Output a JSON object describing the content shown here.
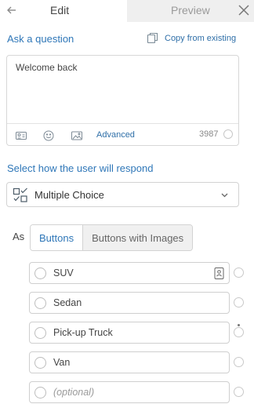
{
  "tabs": {
    "edit": "Edit",
    "preview": "Preview"
  },
  "question": {
    "label": "Ask a question",
    "copy_link": "Copy from existing",
    "text": "Welcome back",
    "advanced": "Advanced",
    "char_count": "3987",
    "tools": [
      "contact-card-icon",
      "emoji-icon",
      "image-icon"
    ]
  },
  "response": {
    "label": "Select how the user will respond",
    "selected": "Multiple Choice"
  },
  "display": {
    "label": "As",
    "buttons": "Buttons",
    "buttons_with_images": "Buttons with Images",
    "active": "Buttons"
  },
  "options": [
    {
      "text": "SUV",
      "placeholder": false
    },
    {
      "text": "Sedan",
      "placeholder": false
    },
    {
      "text": "Pick-up Truck",
      "placeholder": false
    },
    {
      "text": "Van",
      "placeholder": false
    },
    {
      "text": "(optional)",
      "placeholder": true
    }
  ],
  "colors": {
    "accent": "#2f77b8",
    "border": "#d3d3d3",
    "preview_tab_bg": "#efefef"
  }
}
